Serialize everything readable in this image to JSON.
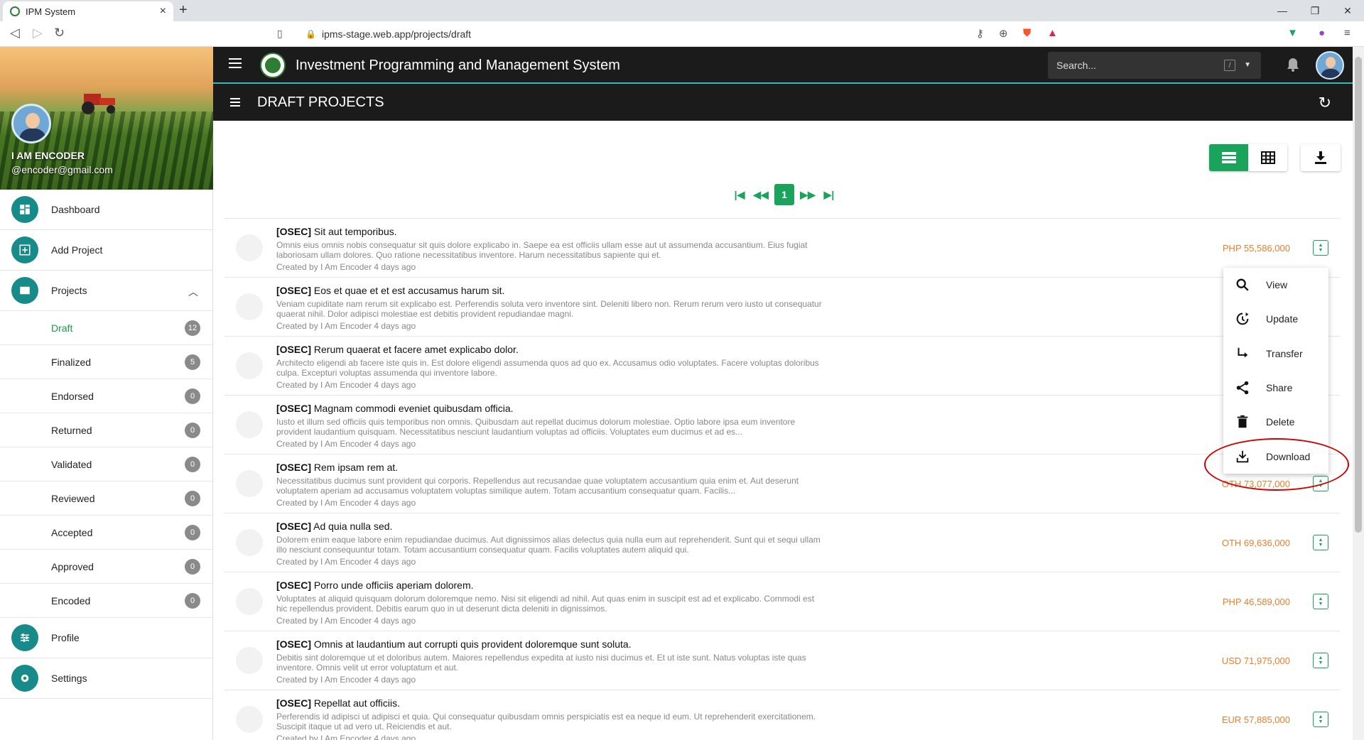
{
  "browser": {
    "tab_title": "IPM System",
    "url": "ipms-stage.web.app/projects/draft"
  },
  "user": {
    "name": "I AM ENCODER",
    "email": "@encoder@gmail.com"
  },
  "sidebar": {
    "items": [
      {
        "label": "Dashboard",
        "icon": "dashboard-icon"
      },
      {
        "label": "Add Project",
        "icon": "add-icon"
      },
      {
        "label": "Projects",
        "icon": "folder-icon"
      },
      {
        "label": "Profile",
        "icon": "sliders-icon"
      },
      {
        "label": "Settings",
        "icon": "gear-icon"
      }
    ],
    "projects_sub": [
      {
        "label": "Draft",
        "count": "12"
      },
      {
        "label": "Finalized",
        "count": "5"
      },
      {
        "label": "Endorsed",
        "count": "0"
      },
      {
        "label": "Returned",
        "count": "0"
      },
      {
        "label": "Validated",
        "count": "0"
      },
      {
        "label": "Reviewed",
        "count": "0"
      },
      {
        "label": "Accepted",
        "count": "0"
      },
      {
        "label": "Approved",
        "count": "0"
      },
      {
        "label": "Encoded",
        "count": "0"
      }
    ]
  },
  "header": {
    "app_title": "Investment Programming and Management System",
    "search_placeholder": "Search...",
    "search_shortcut": "/"
  },
  "page": {
    "title": "DRAFT PROJECTS",
    "current_page": "1"
  },
  "projects": [
    {
      "agency": "[OSEC]",
      "title": "Sit aut temporibus.",
      "desc": "Omnis eius omnis nobis consequatur sit quis dolore explicabo in. Saepe ea est officiis ullam esse aut ut assumenda accusantium. Eius fugiat laboriosam ullam dolores. Quo ratione necessitatibus inventore. Harum necessitatibus sapiente qui et.",
      "meta": "Created by I Am Encoder 4 days ago",
      "amount": "PHP 55,586,000"
    },
    {
      "agency": "[OSEC]",
      "title": "Eos et quae et et est accusamus harum sit.",
      "desc": "Veniam cupiditate nam rerum sit explicabo est. Perferendis soluta vero inventore sint. Deleniti libero non. Rerum rerum vero iusto ut consequatur quaerat nihil. Dolor adipisci molestiae est debitis provident repudiandae magni.",
      "meta": "Created by I Am Encoder 4 days ago",
      "amount": ""
    },
    {
      "agency": "[OSEC]",
      "title": "Rerum quaerat et facere amet explicabo dolor.",
      "desc": "Architecto eligendi ab facere iste quis in. Est dolore eligendi assumenda quos ad quo ex. Accusamus odio voluptates. Facere voluptas doloribus culpa. Excepturi voluptas assumenda qui inventore labore.",
      "meta": "Created by I Am Encoder 4 days ago",
      "amount": ""
    },
    {
      "agency": "[OSEC]",
      "title": "Magnam commodi eveniet quibusdam officia.",
      "desc": "Iusto et illum sed officiis quis temporibus non omnis. Quibusdam aut repellat ducimus dolorum molestiae. Optio labore ipsa eum inventore provident laudantium quisquam. Necessitatibus nesciunt laudantium voluptas ad officiis. Voluptates eum ducimus et ad es...",
      "meta": "Created by I Am Encoder 4 days ago",
      "amount": ""
    },
    {
      "agency": "[OSEC]",
      "title": "Rem ipsam rem at.",
      "desc": "Necessitatibus ducimus sunt provident qui corporis. Repellendus aut recusandae quae voluptatem accusantium quia enim et. Aut deserunt voluptatem aperiam ad accusamus voluptatem voluptas similique autem. Totam accusantium consequatur quam. Facilis...",
      "meta": "Created by I Am Encoder 4 days ago",
      "amount": "OTH 73,077,000"
    },
    {
      "agency": "[OSEC]",
      "title": "Ad quia nulla sed.",
      "desc": "Dolorem enim eaque labore enim repudiandae ducimus. Aut dignissimos alias delectus quia nulla eum aut reprehenderit. Sunt qui et sequi ullam illo nesciunt consequuntur totam. Totam accusantium consequatur quam. Facilis voluptates autem aliquid qui.",
      "meta": "Created by I Am Encoder 4 days ago",
      "amount": "OTH 69,636,000"
    },
    {
      "agency": "[OSEC]",
      "title": "Porro unde officiis aperiam dolorem.",
      "desc": "Voluptates at aliquid quisquam dolorum doloremque nemo. Nisi sit eligendi ad nihil. Aut quas enim in suscipit est ad et explicabo. Commodi est hic repellendus provident. Debitis earum quo in ut deserunt dicta deleniti in dignissimos.",
      "meta": "Created by I Am Encoder 4 days ago",
      "amount": "PHP 46,589,000"
    },
    {
      "agency": "[OSEC]",
      "title": "Omnis at laudantium aut corrupti quis provident doloremque sunt soluta.",
      "desc": "Debitis sint doloremque ut et doloribus autem. Maiores repellendus expedita at iusto nisi ducimus et. Et ut iste sunt. Natus voluptas iste quas inventore. Omnis velit ut error voluptatum et aut.",
      "meta": "Created by I Am Encoder 4 days ago",
      "amount": "USD 71,975,000"
    },
    {
      "agency": "[OSEC]",
      "title": "Repellat aut officiis.",
      "desc": "Perferendis id adipisci ut adipisci et quia. Qui consequatur quibusdam omnis perspiciatis est ea neque id eum. Ut reprehenderit exercitationem. Suscipit itaque ut ad vero ut. Reiciendis et aut.",
      "meta": "Created by I Am Encoder 4 days ago",
      "amount": "EUR 57,885,000"
    }
  ],
  "context_menu": {
    "items": [
      {
        "label": "View",
        "icon": "search-icon"
      },
      {
        "label": "Update",
        "icon": "update-icon"
      },
      {
        "label": "Transfer",
        "icon": "transfer-icon"
      },
      {
        "label": "Share",
        "icon": "share-icon"
      },
      {
        "label": "Delete",
        "icon": "trash-icon"
      },
      {
        "label": "Download",
        "icon": "download-icon"
      }
    ]
  },
  "colors": {
    "accent": "#1aa35a",
    "teal": "#178a8a",
    "amount": "#ef7d2a",
    "appbar": "#1b1b1b",
    "highlight": "#d10000"
  }
}
